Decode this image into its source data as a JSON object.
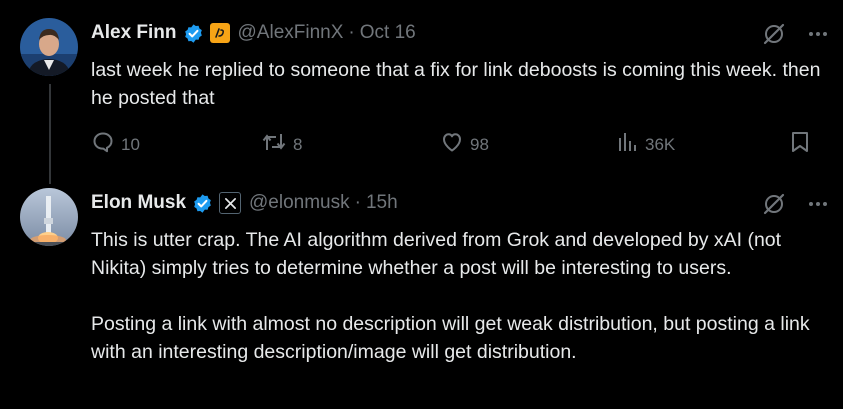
{
  "tweet1": {
    "author_name": "Alex Finn",
    "handle": "@AlexFinnX",
    "separator": "·",
    "date": "Oct 16",
    "text": "last week he replied to someone that a fix for link deboosts is coming this week. then he posted that",
    "actions": {
      "replies": "10",
      "reposts": "8",
      "likes": "98",
      "views": "36K"
    }
  },
  "tweet2": {
    "author_name": "Elon Musk",
    "handle": "@elonmusk",
    "separator": "·",
    "date": "15h",
    "paragraph1": "This is utter crap. The AI algorithm derived from Grok and developed by xAI (not Nikita) simply tries to determine whether a post will be interesting to users.",
    "paragraph2": "Posting a link with almost no description will get weak distribution, but posting a link with an interesting description/image will get distribution."
  },
  "colors": {
    "background": "#000000",
    "text_primary": "#e7e9ea",
    "text_secondary": "#71767b",
    "verified_blue": "#1d9bf0",
    "affiliate_orange": "#f7a416"
  }
}
